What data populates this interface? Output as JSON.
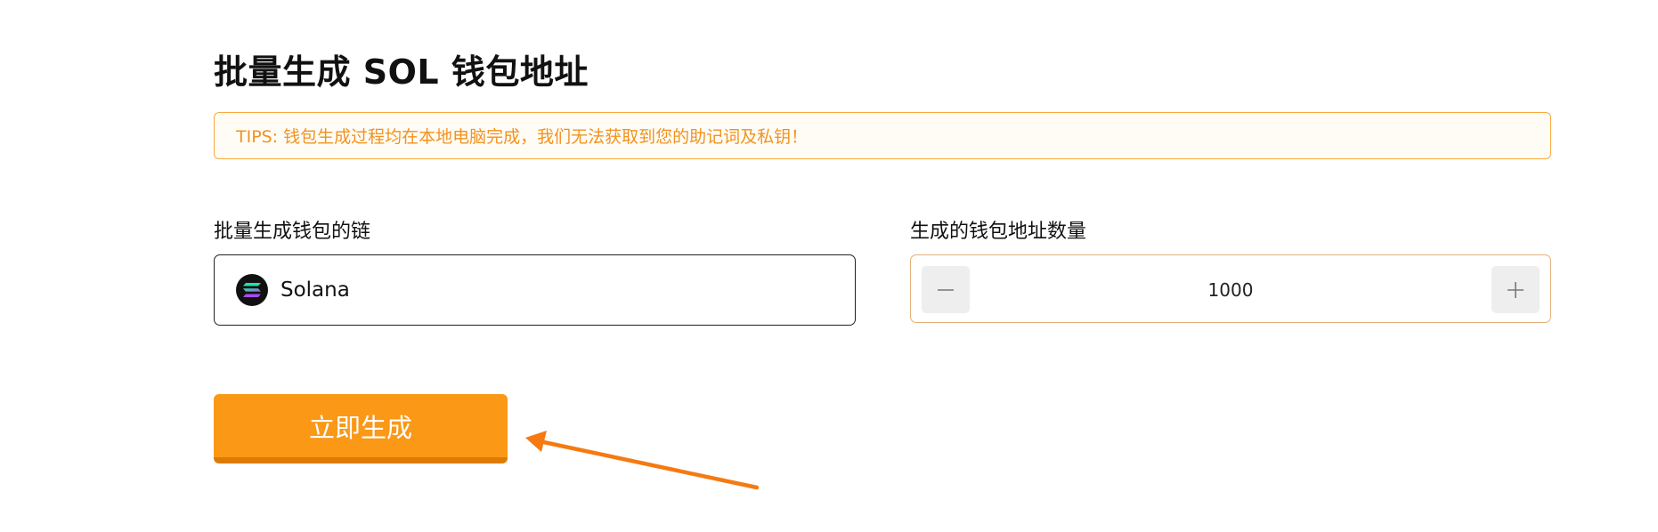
{
  "title": "批量生成 SOL 钱包地址",
  "tips": "TIPS: 钱包生成过程均在本地电脑完成，我们无法获取到您的助记词及私钥！",
  "chain_field": {
    "label": "批量生成钱包的链",
    "selected": "Solana",
    "icon": "solana-logo-icon"
  },
  "count_field": {
    "label": "生成的钱包地址数量",
    "value": "1000",
    "minus_icon": "minus-icon",
    "plus_icon": "plus-icon"
  },
  "generate_button": {
    "label": "立即生成"
  },
  "colors": {
    "accent": "#fb9816",
    "accent_dark": "#dc7c06",
    "tips_text": "#f2921d",
    "tips_border": "#f6a93b",
    "annotation_arrow": "#f57a12"
  }
}
